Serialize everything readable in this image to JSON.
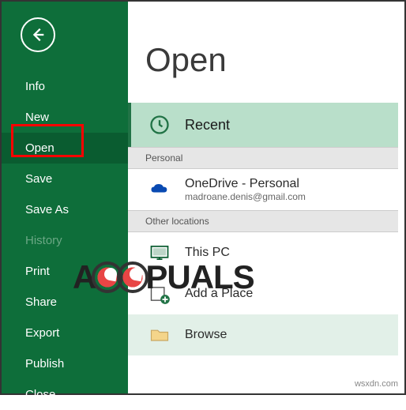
{
  "sidebar": {
    "items": [
      {
        "label": "Info"
      },
      {
        "label": "New"
      },
      {
        "label": "Open",
        "selected": true,
        "highlighted": true
      },
      {
        "label": "Save"
      },
      {
        "label": "Save As"
      },
      {
        "label": "History",
        "disabled": true
      },
      {
        "label": "Print"
      },
      {
        "label": "Share"
      },
      {
        "label": "Export"
      },
      {
        "label": "Publish"
      },
      {
        "label": "Close"
      }
    ]
  },
  "page": {
    "title": "Open"
  },
  "sections": {
    "recent_label": "Recent",
    "personal_header": "Personal",
    "onedrive_label": "OneDrive - Personal",
    "onedrive_sub": "madroane.denis@gmail.com",
    "other_header": "Other locations",
    "thispc_label": "This PC",
    "addplace_label": "Add a Place",
    "browse_label": "Browse"
  },
  "watermarks": {
    "domain": "wsxdn.com",
    "logo_a": "A",
    "logo_rest": "PUALS"
  },
  "colors": {
    "accent": "#0e6e3a",
    "highlight_border": "#ff0000",
    "recent_bg": "#b9dfca",
    "browse_bg": "#e2f0e8"
  }
}
